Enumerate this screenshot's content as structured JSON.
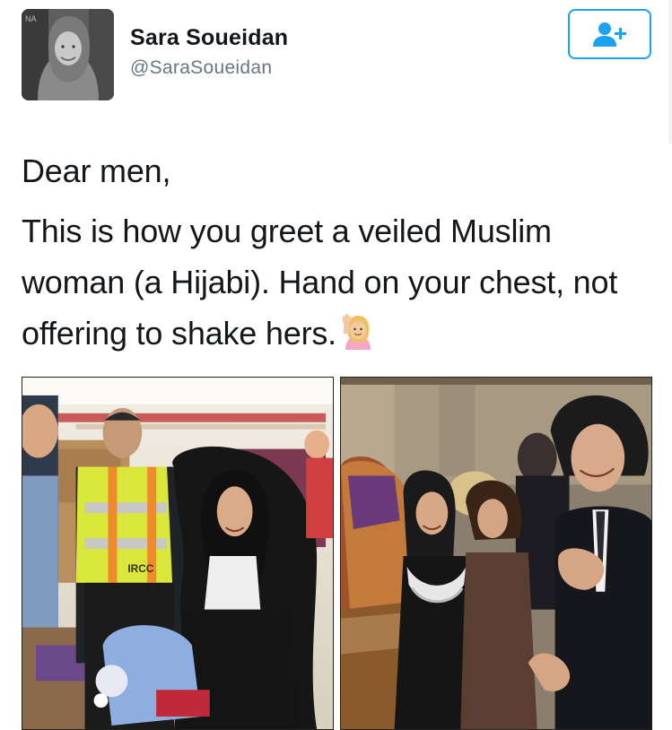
{
  "tweet": {
    "author": {
      "name": "Sara Soueidan",
      "handle": "@SaraSoueidan",
      "avatar_icon": "user-avatar-photo"
    },
    "follow_button": {
      "icon": "add-user-icon",
      "color": "#1da1f2"
    },
    "text": {
      "line1": "Dear men,",
      "line2": "This is how you greet a veiled Muslim woman (a Hijabi). Hand on your chest, not offering to shake hers.",
      "emoji": "raising-hand-emoji"
    },
    "photos": [
      {
        "name": "photo-refugee-welcome",
        "badge_text": "IRCC"
      },
      {
        "name": "photo-hand-on-chest-greeting"
      }
    ]
  }
}
